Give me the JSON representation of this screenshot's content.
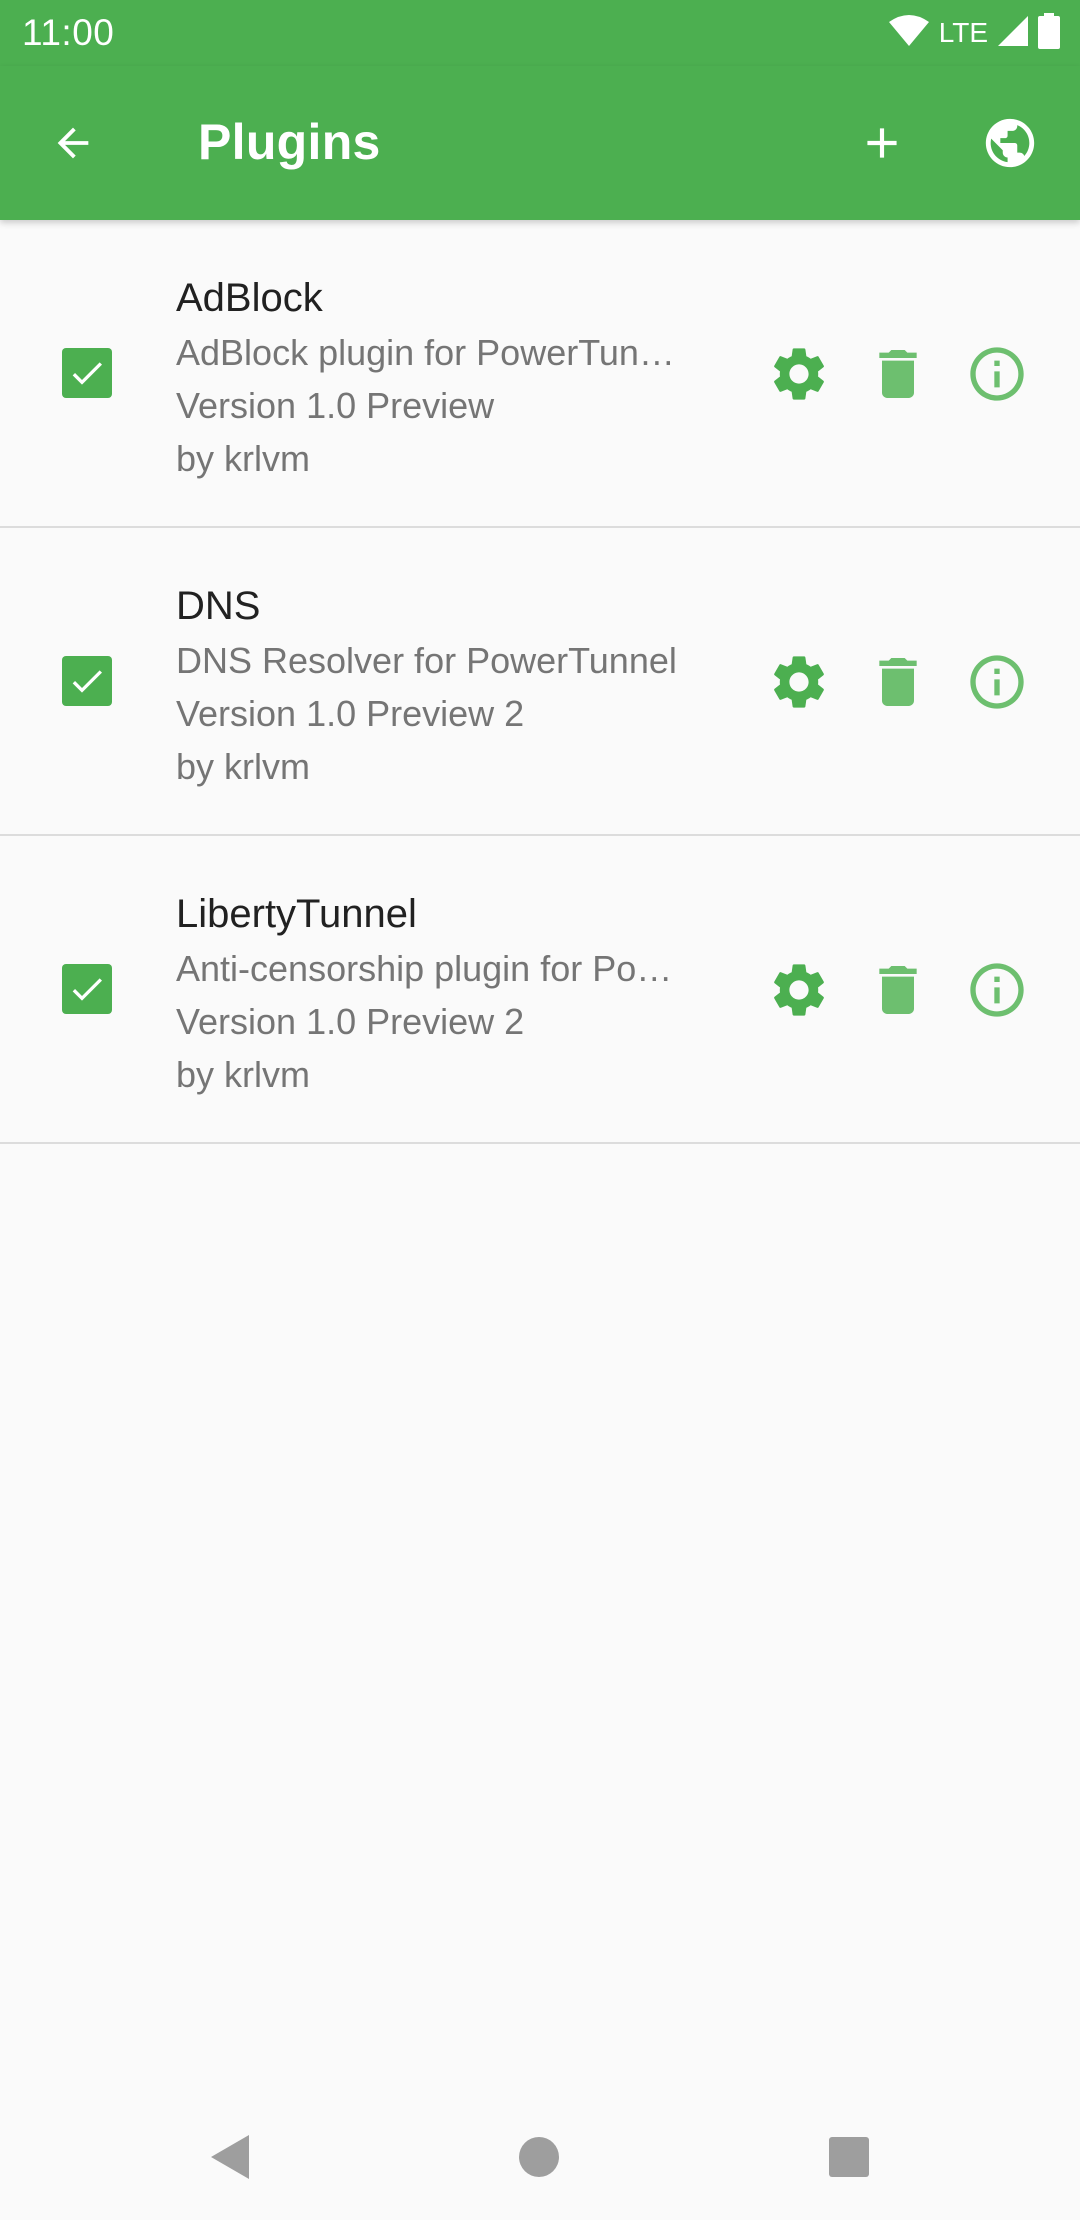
{
  "status_bar": {
    "time": "11:00",
    "network": "LTE"
  },
  "app_bar": {
    "title": "Plugins",
    "icons": {
      "back": "arrow-left-icon",
      "add": "plus-icon",
      "globe": "globe-icon"
    }
  },
  "colors": {
    "primary": "#4caf50",
    "icon_green": "#6dbf6f",
    "text_primary": "#212121",
    "text_secondary": "#757575",
    "divider": "#dcdcdc",
    "background": "#fafafa"
  },
  "plugins": [
    {
      "name": "AdBlock",
      "description": "AdBlock plugin for PowerTun…",
      "version": "Version 1.0 Preview",
      "author": "by krlvm",
      "enabled": true
    },
    {
      "name": "DNS",
      "description": "DNS Resolver for PowerTunnel",
      "version": "Version 1.0 Preview 2",
      "author": "by krlvm",
      "enabled": true
    },
    {
      "name": "LibertyTunnel",
      "description": "Anti-censorship plugin for Po…",
      "version": "Version 1.0 Preview 2",
      "author": "by krlvm",
      "enabled": true
    }
  ],
  "row_icons": [
    "gear-icon",
    "trash-icon",
    "info-icon"
  ],
  "nav_bar": [
    "back-triangle-icon",
    "home-circle-icon",
    "recents-square-icon"
  ]
}
